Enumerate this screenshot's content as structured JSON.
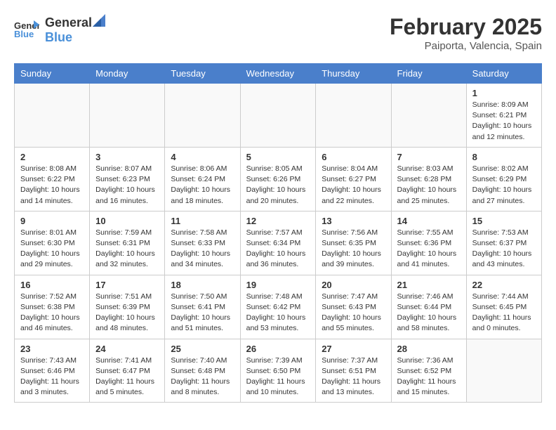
{
  "header": {
    "logo_general": "General",
    "logo_blue": "Blue",
    "month": "February 2025",
    "location": "Paiporta, Valencia, Spain"
  },
  "days_of_week": [
    "Sunday",
    "Monday",
    "Tuesday",
    "Wednesday",
    "Thursday",
    "Friday",
    "Saturday"
  ],
  "weeks": [
    [
      {
        "day": "",
        "info": ""
      },
      {
        "day": "",
        "info": ""
      },
      {
        "day": "",
        "info": ""
      },
      {
        "day": "",
        "info": ""
      },
      {
        "day": "",
        "info": ""
      },
      {
        "day": "",
        "info": ""
      },
      {
        "day": "1",
        "info": "Sunrise: 8:09 AM\nSunset: 6:21 PM\nDaylight: 10 hours\nand 12 minutes."
      }
    ],
    [
      {
        "day": "2",
        "info": "Sunrise: 8:08 AM\nSunset: 6:22 PM\nDaylight: 10 hours\nand 14 minutes."
      },
      {
        "day": "3",
        "info": "Sunrise: 8:07 AM\nSunset: 6:23 PM\nDaylight: 10 hours\nand 16 minutes."
      },
      {
        "day": "4",
        "info": "Sunrise: 8:06 AM\nSunset: 6:24 PM\nDaylight: 10 hours\nand 18 minutes."
      },
      {
        "day": "5",
        "info": "Sunrise: 8:05 AM\nSunset: 6:26 PM\nDaylight: 10 hours\nand 20 minutes."
      },
      {
        "day": "6",
        "info": "Sunrise: 8:04 AM\nSunset: 6:27 PM\nDaylight: 10 hours\nand 22 minutes."
      },
      {
        "day": "7",
        "info": "Sunrise: 8:03 AM\nSunset: 6:28 PM\nDaylight: 10 hours\nand 25 minutes."
      },
      {
        "day": "8",
        "info": "Sunrise: 8:02 AM\nSunset: 6:29 PM\nDaylight: 10 hours\nand 27 minutes."
      }
    ],
    [
      {
        "day": "9",
        "info": "Sunrise: 8:01 AM\nSunset: 6:30 PM\nDaylight: 10 hours\nand 29 minutes."
      },
      {
        "day": "10",
        "info": "Sunrise: 7:59 AM\nSunset: 6:31 PM\nDaylight: 10 hours\nand 32 minutes."
      },
      {
        "day": "11",
        "info": "Sunrise: 7:58 AM\nSunset: 6:33 PM\nDaylight: 10 hours\nand 34 minutes."
      },
      {
        "day": "12",
        "info": "Sunrise: 7:57 AM\nSunset: 6:34 PM\nDaylight: 10 hours\nand 36 minutes."
      },
      {
        "day": "13",
        "info": "Sunrise: 7:56 AM\nSunset: 6:35 PM\nDaylight: 10 hours\nand 39 minutes."
      },
      {
        "day": "14",
        "info": "Sunrise: 7:55 AM\nSunset: 6:36 PM\nDaylight: 10 hours\nand 41 minutes."
      },
      {
        "day": "15",
        "info": "Sunrise: 7:53 AM\nSunset: 6:37 PM\nDaylight: 10 hours\nand 43 minutes."
      }
    ],
    [
      {
        "day": "16",
        "info": "Sunrise: 7:52 AM\nSunset: 6:38 PM\nDaylight: 10 hours\nand 46 minutes."
      },
      {
        "day": "17",
        "info": "Sunrise: 7:51 AM\nSunset: 6:39 PM\nDaylight: 10 hours\nand 48 minutes."
      },
      {
        "day": "18",
        "info": "Sunrise: 7:50 AM\nSunset: 6:41 PM\nDaylight: 10 hours\nand 51 minutes."
      },
      {
        "day": "19",
        "info": "Sunrise: 7:48 AM\nSunset: 6:42 PM\nDaylight: 10 hours\nand 53 minutes."
      },
      {
        "day": "20",
        "info": "Sunrise: 7:47 AM\nSunset: 6:43 PM\nDaylight: 10 hours\nand 55 minutes."
      },
      {
        "day": "21",
        "info": "Sunrise: 7:46 AM\nSunset: 6:44 PM\nDaylight: 10 hours\nand 58 minutes."
      },
      {
        "day": "22",
        "info": "Sunrise: 7:44 AM\nSunset: 6:45 PM\nDaylight: 11 hours\nand 0 minutes."
      }
    ],
    [
      {
        "day": "23",
        "info": "Sunrise: 7:43 AM\nSunset: 6:46 PM\nDaylight: 11 hours\nand 3 minutes."
      },
      {
        "day": "24",
        "info": "Sunrise: 7:41 AM\nSunset: 6:47 PM\nDaylight: 11 hours\nand 5 minutes."
      },
      {
        "day": "25",
        "info": "Sunrise: 7:40 AM\nSunset: 6:48 PM\nDaylight: 11 hours\nand 8 minutes."
      },
      {
        "day": "26",
        "info": "Sunrise: 7:39 AM\nSunset: 6:50 PM\nDaylight: 11 hours\nand 10 minutes."
      },
      {
        "day": "27",
        "info": "Sunrise: 7:37 AM\nSunset: 6:51 PM\nDaylight: 11 hours\nand 13 minutes."
      },
      {
        "day": "28",
        "info": "Sunrise: 7:36 AM\nSunset: 6:52 PM\nDaylight: 11 hours\nand 15 minutes."
      },
      {
        "day": "",
        "info": ""
      }
    ]
  ]
}
